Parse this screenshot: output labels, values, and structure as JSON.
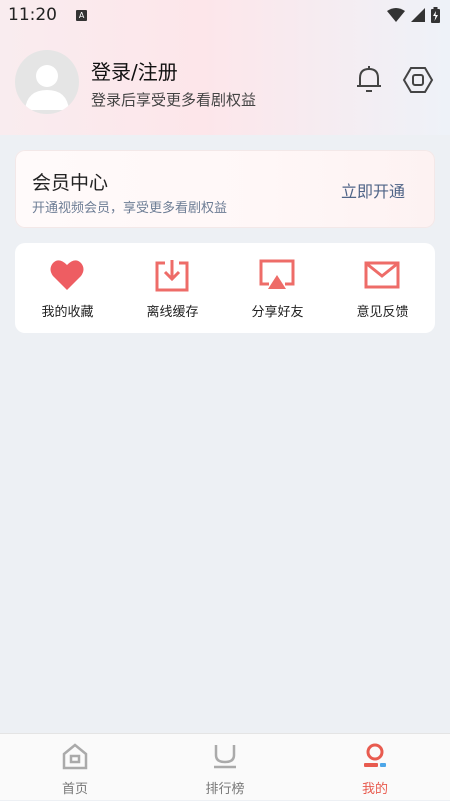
{
  "status_bar": {
    "time": "11:20",
    "badge": "A"
  },
  "profile": {
    "title": "登录/注册",
    "subtitle": "登录后享受更多看剧权益",
    "bell_icon": "bell-icon",
    "settings_icon": "hexagon-settings-icon"
  },
  "vip": {
    "title": "会员中心",
    "subtitle": "开通视频会员，享受更多看剧权益",
    "button": "立即开通"
  },
  "actions": [
    {
      "label": "我的收藏",
      "icon": "heart-icon"
    },
    {
      "label": "离线缓存",
      "icon": "download-icon"
    },
    {
      "label": "分享好友",
      "icon": "share-screen-icon"
    },
    {
      "label": "意见反馈",
      "icon": "mail-icon"
    }
  ],
  "tabs": [
    {
      "label": "首页",
      "icon": "home-icon",
      "active": false
    },
    {
      "label": "排行榜",
      "icon": "ranking-icon",
      "active": false
    },
    {
      "label": "我的",
      "icon": "profile-icon",
      "active": true
    }
  ],
  "colors": {
    "accent": "#e85b4f",
    "icon_red": "#ee6c68",
    "vip_text": "#4f6487"
  }
}
